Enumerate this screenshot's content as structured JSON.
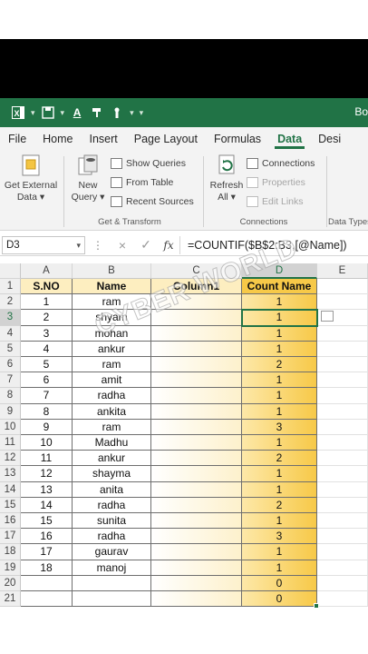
{
  "app": {
    "title_fragment": "Bo"
  },
  "ribbon_tabs": [
    "File",
    "Home",
    "Insert",
    "Page Layout",
    "Formulas",
    "Data",
    "Desi"
  ],
  "active_tab": "Data",
  "ribbon": {
    "get_external": [
      "Get External",
      "Data ▾"
    ],
    "new_query": [
      "New",
      "Query ▾"
    ],
    "show_queries": "Show Queries",
    "from_table": "From Table",
    "recent_sources": "Recent Sources",
    "get_transform_label": "Get & Transform",
    "refresh": [
      "Refresh",
      "All ▾"
    ],
    "connections": "Connections",
    "properties": "Properties",
    "edit_links": "Edit Links",
    "connections_label": "Connections",
    "data_types_label": "Data Types"
  },
  "formula_bar": {
    "name_box": "D3",
    "cancel_symbol": "×",
    "enter_symbol": "✓",
    "fx": "fx",
    "formula": "=COUNTIF($B$2:B3,[@Name])"
  },
  "columns": [
    "A",
    "B",
    "C",
    "D",
    "E"
  ],
  "selected_column": "D",
  "selected_row": 3,
  "rows": [
    "1",
    "2",
    "3",
    "4",
    "5",
    "6",
    "7",
    "8",
    "9",
    "10",
    "11",
    "12",
    "13",
    "14",
    "15",
    "16",
    "17",
    "18",
    "19",
    "20",
    "21"
  ],
  "table": {
    "headers": [
      "S.NO",
      "Name",
      "Column1",
      "Count Name"
    ],
    "data": [
      [
        "1",
        "ram",
        "",
        "1"
      ],
      [
        "2",
        "shyam",
        "",
        "1"
      ],
      [
        "3",
        "mohan",
        "",
        "1"
      ],
      [
        "4",
        "ankur",
        "",
        "1"
      ],
      [
        "5",
        "ram",
        "",
        "2"
      ],
      [
        "6",
        "amit",
        "",
        "1"
      ],
      [
        "7",
        "radha",
        "",
        "1"
      ],
      [
        "8",
        "ankita",
        "",
        "1"
      ],
      [
        "9",
        "ram",
        "",
        "3"
      ],
      [
        "10",
        "Madhu",
        "",
        "1"
      ],
      [
        "11",
        "ankur",
        "",
        "2"
      ],
      [
        "12",
        "shayma",
        "",
        "1"
      ],
      [
        "13",
        "anita",
        "",
        "1"
      ],
      [
        "14",
        "radha",
        "",
        "2"
      ],
      [
        "15",
        "sunita",
        "",
        "1"
      ],
      [
        "16",
        "radha",
        "",
        "3"
      ],
      [
        "17",
        "gaurav",
        "",
        "1"
      ],
      [
        "18",
        "manoj",
        "",
        "1"
      ],
      [
        "",
        "",
        "",
        "0"
      ],
      [
        "",
        "",
        "",
        "0"
      ]
    ]
  },
  "watermark": "CYBER WORLD",
  "colors": {
    "excel_green": "#217346",
    "highlight_yellow": "#f7c948",
    "table_fill": "#fde8a8"
  }
}
